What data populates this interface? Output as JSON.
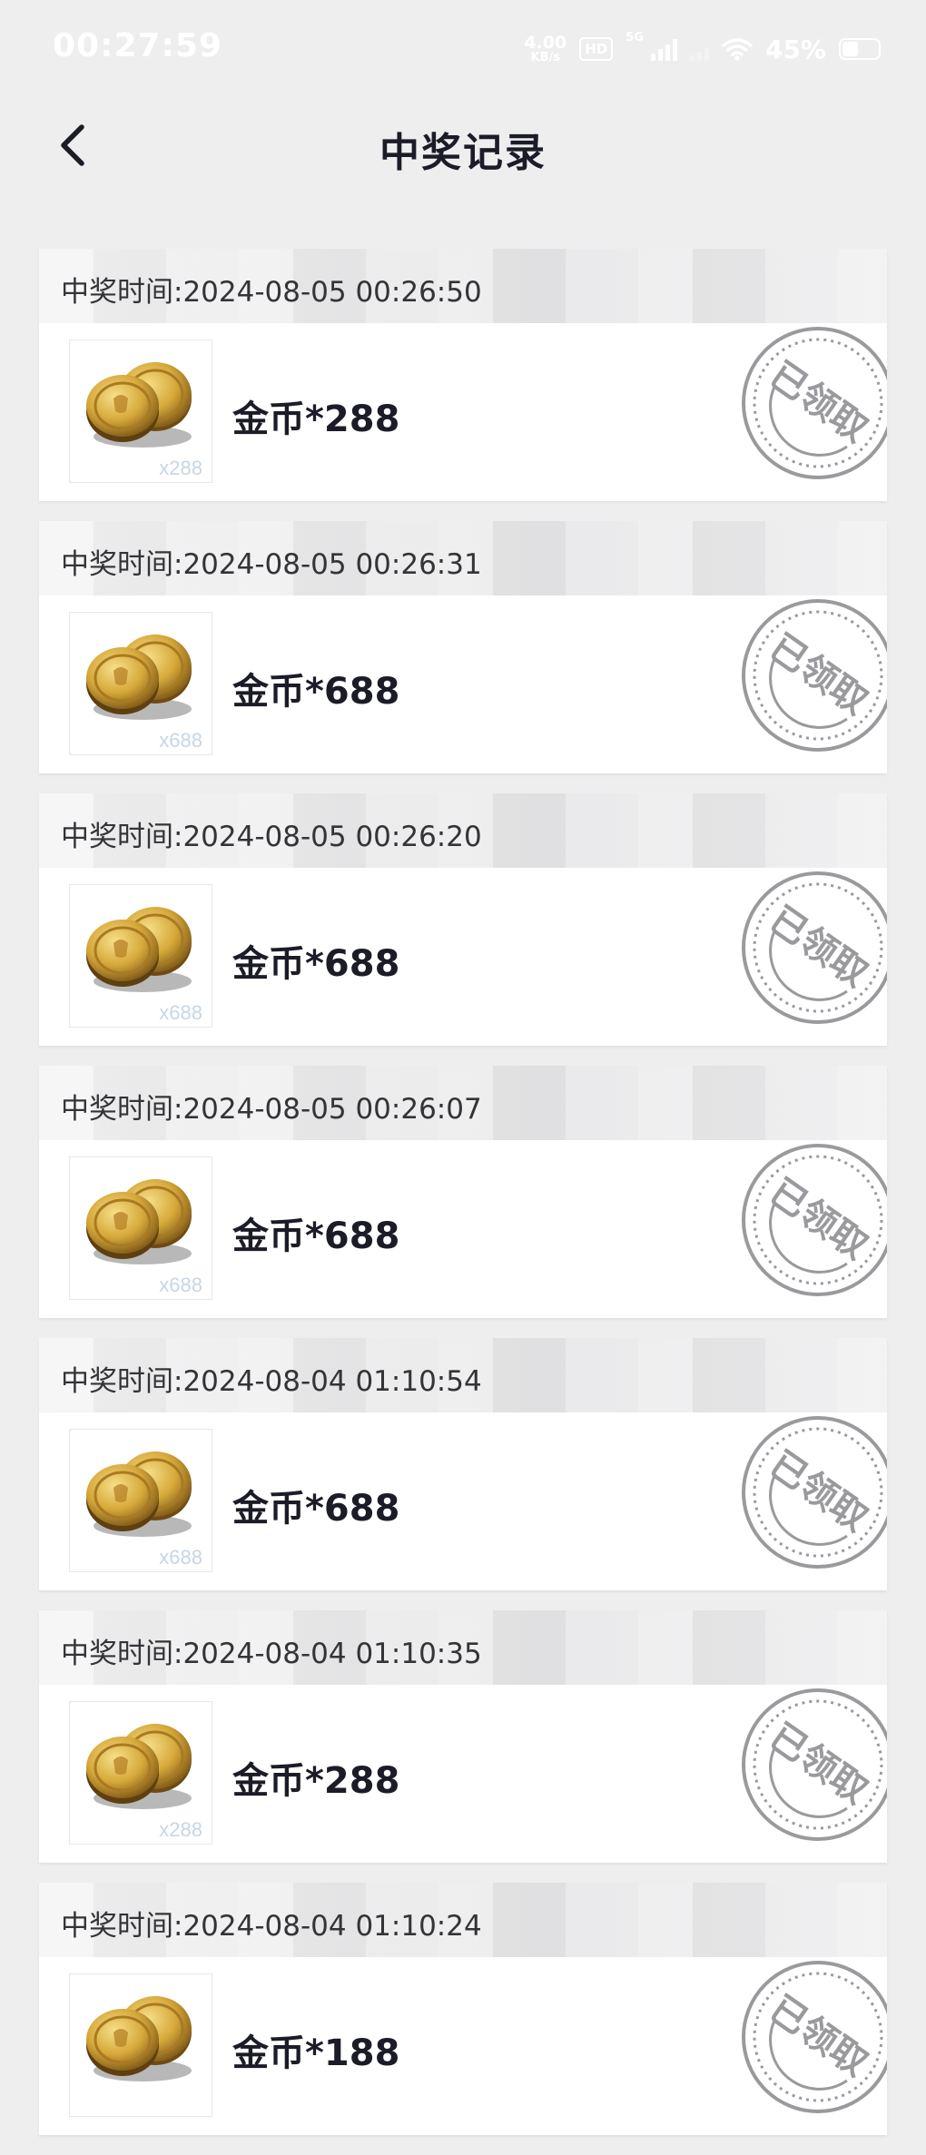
{
  "status_bar": {
    "time": "00:27:59",
    "net_speed_value": "4.00",
    "net_speed_unit": "KB/s",
    "hd_label": "HD",
    "network_label": "5G",
    "battery_percent": "45%"
  },
  "header": {
    "title": "中奖记录"
  },
  "records": [
    {
      "time_label": "中奖时间:2024-08-05 00:26:50",
      "item_name": "金币*288",
      "qty_tag": "x288",
      "stamp": "已领取"
    },
    {
      "time_label": "中奖时间:2024-08-05 00:26:31",
      "item_name": "金币*688",
      "qty_tag": "x688",
      "stamp": "已领取"
    },
    {
      "time_label": "中奖时间:2024-08-05 00:26:20",
      "item_name": "金币*688",
      "qty_tag": "x688",
      "stamp": "已领取"
    },
    {
      "time_label": "中奖时间:2024-08-05 00:26:07",
      "item_name": "金币*688",
      "qty_tag": "x688",
      "stamp": "已领取"
    },
    {
      "time_label": "中奖时间:2024-08-04 01:10:54",
      "item_name": "金币*688",
      "qty_tag": "x688",
      "stamp": "已领取"
    },
    {
      "time_label": "中奖时间:2024-08-04 01:10:35",
      "item_name": "金币*288",
      "qty_tag": "x288",
      "stamp": "已领取"
    },
    {
      "time_label": "中奖时间:2024-08-04 01:10:24",
      "item_name": "金币*188",
      "qty_tag": "",
      "stamp": "已领取"
    }
  ],
  "icons": {
    "back": "chevron-left-icon",
    "item": "gold-coins-icon",
    "stamp": "claimed-stamp-icon",
    "wifi": "wifi-icon",
    "battery": "battery-icon"
  },
  "colors": {
    "background": "#eeeeef",
    "card": "#ffffff",
    "title_text": "#1c1c28",
    "stamp": "#9a9a9e"
  }
}
